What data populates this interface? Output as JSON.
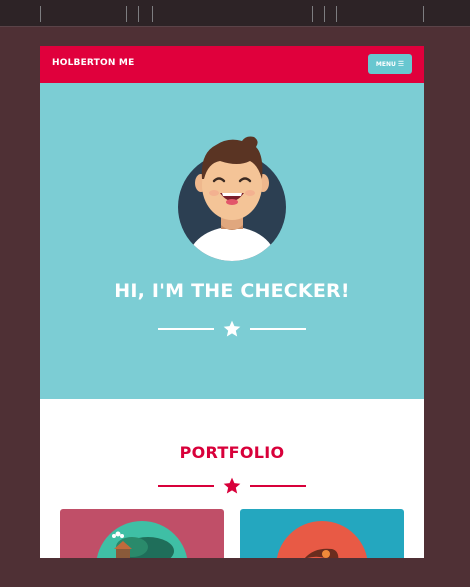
{
  "navbar": {
    "brand": "HOLBERTON ME",
    "menu_label": "MENU",
    "menu_icon": "hamburger-icon"
  },
  "hero": {
    "title": "HI, I'M THE CHECKER!",
    "avatar_icon": "smiling-person-avatar",
    "divider_icon": "star-icon"
  },
  "portfolio": {
    "title": "PORTFOLIO",
    "divider_icon": "star-icon",
    "cards": [
      {
        "icon": "tree-house-illustration",
        "color": "#c04f68"
      },
      {
        "icon": "orange-circle-illustration",
        "color": "#24a7bf"
      }
    ]
  },
  "colors": {
    "primary": "#e0003c",
    "hero_bg": "#7ccdd4",
    "accent": "#68c7d0",
    "page_bg": "#4f3035"
  }
}
